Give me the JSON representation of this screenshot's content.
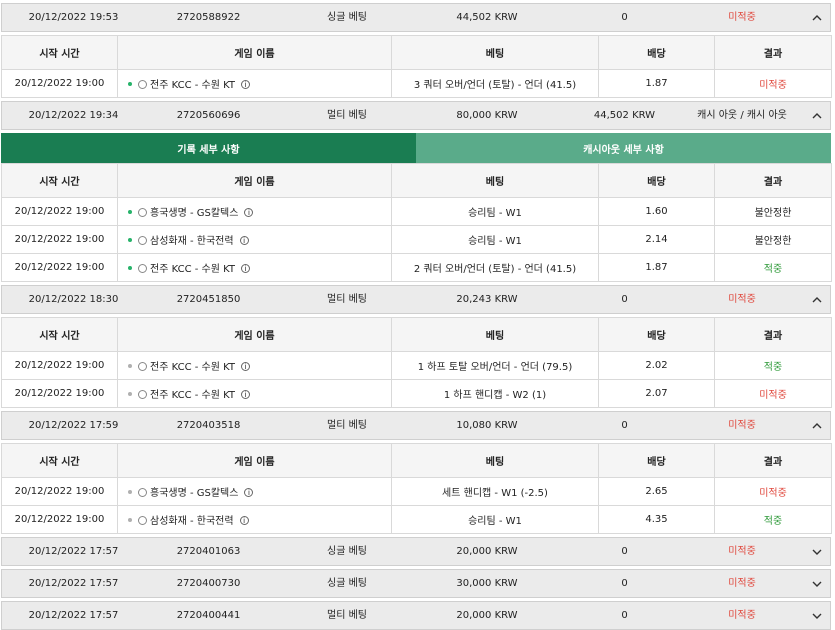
{
  "headers": {
    "start": "시작 시간",
    "game": "게임 이름",
    "bet": "베팅",
    "odds": "배당",
    "result": "결과"
  },
  "tabs": {
    "history": "기록 세부 사항",
    "cashout": "캐시아웃 세부 사항"
  },
  "info_glyph": "i",
  "bets": [
    {
      "date": "20/12/2022 19:53",
      "id": "2720588922",
      "type": "싱글 베팅",
      "amount": "44,502 KRW",
      "win": "0",
      "status": "미적중",
      "rows": [
        {
          "start": "20/12/2022 19:00",
          "game": "전주 KCC - 수원 KT",
          "bet": "3 쿼터 오버/언더 (토탈) - 언더 (41.5)",
          "odds": "1.87",
          "result": "미적중"
        }
      ]
    },
    {
      "date": "20/12/2022 19:34",
      "id": "2720560696",
      "type": "멀티 베팅",
      "amount": "80,000 KRW",
      "win": "44,502 KRW",
      "status": "캐시 아웃 / 캐시 아웃",
      "rows": [
        {
          "start": "20/12/2022 19:00",
          "game": "흥국생명 - GS칼텍스",
          "bet": "승리팀 - W1",
          "odds": "1.60",
          "result": "불안정한"
        },
        {
          "start": "20/12/2022 19:00",
          "game": "삼성화재 - 한국전력",
          "bet": "승리팀 - W1",
          "odds": "2.14",
          "result": "불안정한"
        },
        {
          "start": "20/12/2022 19:00",
          "game": "전주 KCC - 수원 KT",
          "bet": "2 쿼터 오버/언더 (토탈) - 언더 (41.5)",
          "odds": "1.87",
          "result": "적중"
        }
      ]
    },
    {
      "date": "20/12/2022 18:30",
      "id": "2720451850",
      "type": "멀티 베팅",
      "amount": "20,243 KRW",
      "win": "0",
      "status": "미적중",
      "rows": [
        {
          "start": "20/12/2022 19:00",
          "game": "전주 KCC - 수원 KT",
          "bet": "1 하프 토탈 오버/언더 - 언더 (79.5)",
          "odds": "2.02",
          "result": "적중"
        },
        {
          "start": "20/12/2022 19:00",
          "game": "전주 KCC - 수원 KT",
          "bet": "1 하프 핸디캡 - W2 (1)",
          "odds": "2.07",
          "result": "미적중"
        }
      ]
    },
    {
      "date": "20/12/2022 17:59",
      "id": "2720403518",
      "type": "멀티 베팅",
      "amount": "10,080 KRW",
      "win": "0",
      "status": "미적중",
      "rows": [
        {
          "start": "20/12/2022 19:00",
          "game": "흥국생명 - GS칼텍스",
          "bet": "세트 핸디캡 - W1 (-2.5)",
          "odds": "2.65",
          "result": "미적중"
        },
        {
          "start": "20/12/2022 19:00",
          "game": "삼성화재 - 한국전력",
          "bet": "승리팀 - W1",
          "odds": "4.35",
          "result": "적중"
        }
      ]
    },
    {
      "date": "20/12/2022 17:57",
      "id": "2720401063",
      "type": "싱글 베팅",
      "amount": "20,000 KRW",
      "win": "0",
      "status": "미적중"
    },
    {
      "date": "20/12/2022 17:57",
      "id": "2720400730",
      "type": "싱글 베팅",
      "amount": "30,000 KRW",
      "win": "0",
      "status": "미적중"
    },
    {
      "date": "20/12/2022 17:57",
      "id": "2720400441",
      "type": "멀티 베팅",
      "amount": "20,000 KRW",
      "win": "0",
      "status": "미적중"
    }
  ],
  "colors": {
    "lost": "#e04a3f",
    "won": "#2f9a3a",
    "tab_active": "#1a7d52",
    "tab_inactive": "#5aab8a"
  }
}
